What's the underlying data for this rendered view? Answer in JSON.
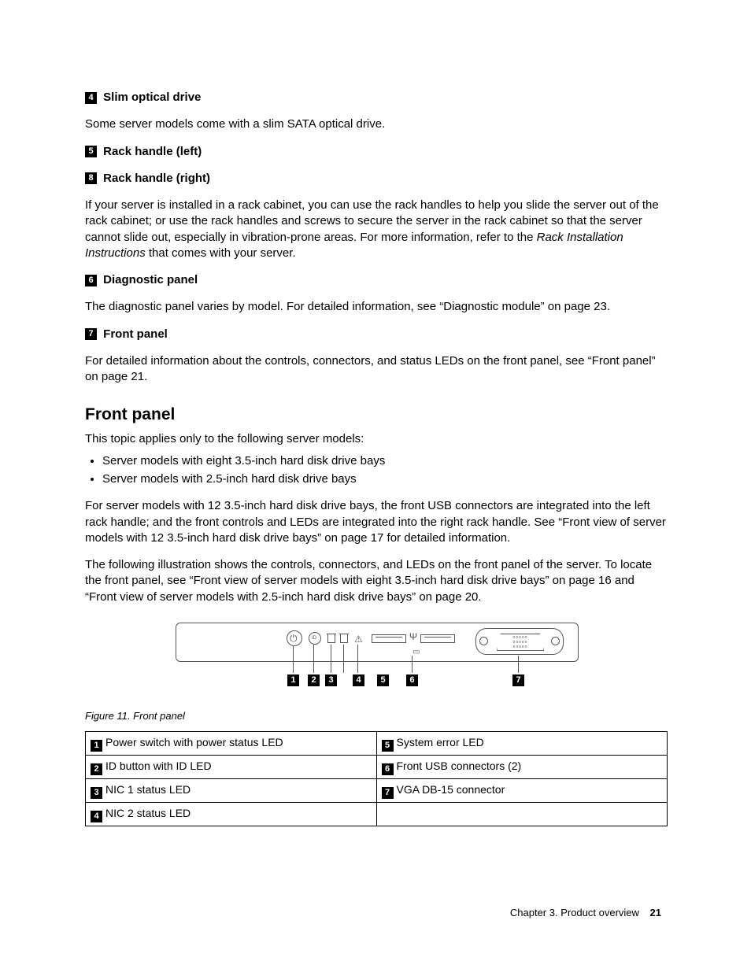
{
  "items": {
    "i4": {
      "num": "4",
      "title": "Slim optical drive",
      "body": "Some server models come with a slim SATA optical drive."
    },
    "i5": {
      "num": "5",
      "title": "Rack handle (left)"
    },
    "i8": {
      "num": "8",
      "title": "Rack handle (right)",
      "body": "If your server is installed in a rack cabinet, you can use the rack handles to help you slide the server out of the rack cabinet; or use the rack handles and screws to secure the server in the rack cabinet so that the server cannot slide out, especially in vibration-prone areas. For more information, refer to the ",
      "body_ital": "Rack Installation Instructions",
      "body_tail": " that comes with your server."
    },
    "i6": {
      "num": "6",
      "title": "Diagnostic panel",
      "body": "The diagnostic panel varies by model. For detailed information, see “Diagnostic module” on page 23."
    },
    "i7": {
      "num": "7",
      "title": "Front panel",
      "body": "For detailed information about the controls, connectors, and status LEDs on the front panel, see “Front panel” on page 21."
    }
  },
  "section": {
    "heading": "Front panel",
    "intro": "This topic applies only to the following server models:",
    "bullets": [
      "Server models with eight 3.5-inch hard disk drive bays",
      "Server models with 2.5-inch hard disk drive bays"
    ],
    "p2": "For server models with 12 3.5-inch hard disk drive bays, the front USB connectors are integrated into the left rack handle; and the front controls and LEDs are integrated into the right rack handle. See “Front view of server models with 12 3.5-inch hard disk drive bays” on page 17 for detailed information.",
    "p3": "The following illustration shows the controls, connectors, and LEDs on the front panel of the server. To locate the front panel, see “Front view of server models with eight 3.5-inch hard disk drive bays” on page 16 and “Front view of server models with 2.5-inch hard disk drive bays” on page 20."
  },
  "figure": {
    "caption": "Figure 11.  Front panel",
    "callouts": [
      "1",
      "2",
      "3",
      "4",
      "5",
      "6",
      "7"
    ]
  },
  "legend": [
    {
      "n": "1",
      "t": "Power switch with power status LED"
    },
    {
      "n": "5",
      "t": "System error LED"
    },
    {
      "n": "2",
      "t": "ID button with ID LED"
    },
    {
      "n": "6",
      "t": "Front USB connectors (2)"
    },
    {
      "n": "3",
      "t": "NIC 1 status LED"
    },
    {
      "n": "7",
      "t": "VGA DB-15 connector"
    },
    {
      "n": "4",
      "t": "NIC 2 status LED"
    },
    {
      "n": "",
      "t": ""
    }
  ],
  "footer": {
    "chapter": "Chapter 3.  Product overview",
    "page": "21"
  }
}
